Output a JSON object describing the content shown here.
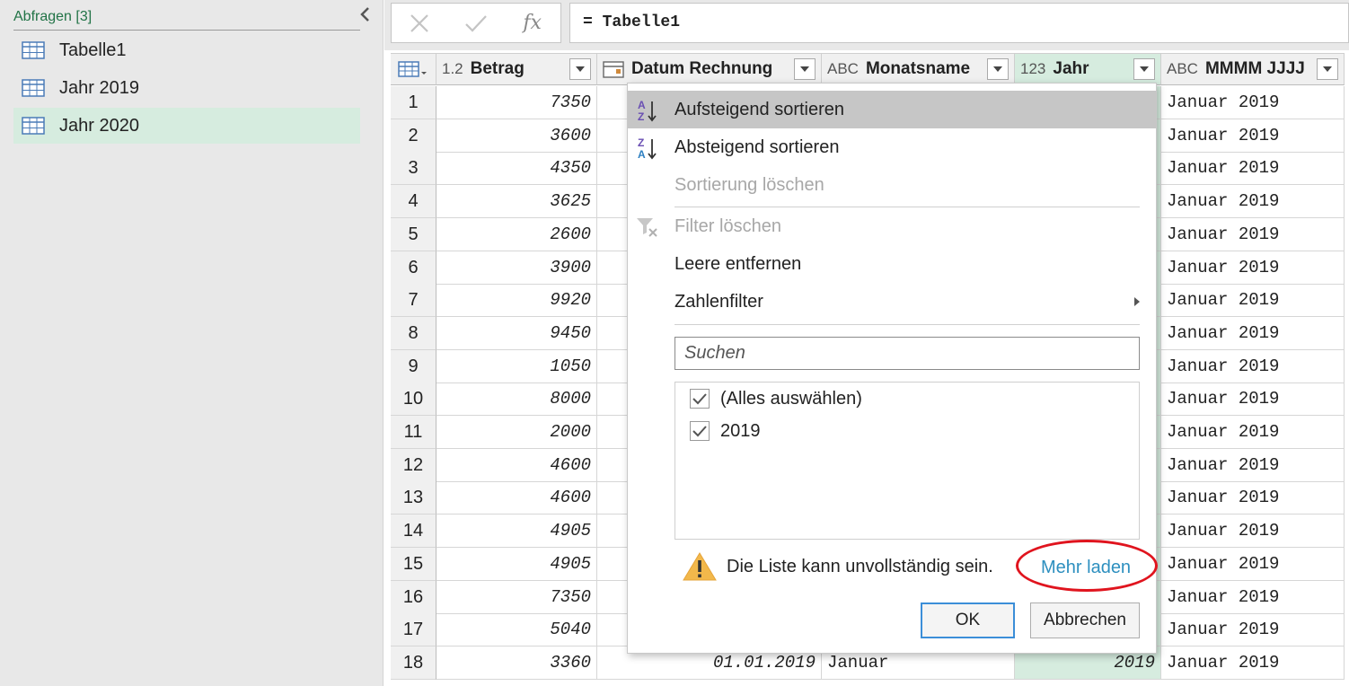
{
  "queries_pane": {
    "header": "Abfragen [3]",
    "items": [
      {
        "label": "Tabelle1",
        "selected": false
      },
      {
        "label": "Jahr 2019",
        "selected": false
      },
      {
        "label": "Jahr 2020",
        "selected": true
      }
    ]
  },
  "formula_bar": {
    "fx_label": "fx",
    "formula": "= Tabelle1"
  },
  "grid": {
    "columns": [
      {
        "type_icon": "1.2",
        "name": "Betrag"
      },
      {
        "type_icon": "calendar-icon",
        "name": "Datum Rechnung"
      },
      {
        "type_icon": "ABC",
        "name": "Monatsname"
      },
      {
        "type_icon": "123",
        "name": "Jahr"
      },
      {
        "type_icon": "ABC",
        "name": "MMMM JJJJ"
      }
    ],
    "rows": [
      {
        "num": "1",
        "betrag": "7350",
        "mmmm": "Januar 2019"
      },
      {
        "num": "2",
        "betrag": "3600",
        "mmmm": "Januar 2019"
      },
      {
        "num": "3",
        "betrag": "4350",
        "mmmm": "Januar 2019"
      },
      {
        "num": "4",
        "betrag": "3625",
        "mmmm": "Januar 2019"
      },
      {
        "num": "5",
        "betrag": "2600",
        "mmmm": "Januar 2019"
      },
      {
        "num": "6",
        "betrag": "3900",
        "mmmm": "Januar 2019"
      },
      {
        "num": "7",
        "betrag": "9920",
        "mmmm": "Januar 2019"
      },
      {
        "num": "8",
        "betrag": "9450",
        "mmmm": "Januar 2019"
      },
      {
        "num": "9",
        "betrag": "1050",
        "mmmm": "Januar 2019"
      },
      {
        "num": "10",
        "betrag": "8000",
        "mmmm": "Januar 2019"
      },
      {
        "num": "11",
        "betrag": "2000",
        "mmmm": "Januar 2019"
      },
      {
        "num": "12",
        "betrag": "4600",
        "mmmm": "Januar 2019"
      },
      {
        "num": "13",
        "betrag": "4600",
        "mmmm": "Januar 2019"
      },
      {
        "num": "14",
        "betrag": "4905",
        "mmmm": "Januar 2019"
      },
      {
        "num": "15",
        "betrag": "4905",
        "mmmm": "Januar 2019"
      },
      {
        "num": "16",
        "betrag": "7350",
        "mmmm": "Januar 2019"
      },
      {
        "num": "17",
        "betrag": "5040",
        "mmmm": "Januar 2019"
      },
      {
        "num": "18",
        "betrag": "3360",
        "datum": "01.01.2019",
        "monat": "Januar",
        "jahr": "2019",
        "mmmm": "Januar 2019"
      }
    ]
  },
  "filter_menu": {
    "sort_asc": "Aufsteigend sortieren",
    "sort_desc": "Absteigend sortieren",
    "clear_sort": "Sortierung löschen",
    "clear_filter": "Filter löschen",
    "remove_empty": "Leere entfernen",
    "number_filter": "Zahlenfilter",
    "search_placeholder": "Suchen",
    "values": [
      {
        "label": "(Alles auswählen)",
        "checked": true
      },
      {
        "label": "2019",
        "checked": true
      }
    ],
    "warning": "Die Liste kann unvollständig sein.",
    "load_more": "Mehr laden",
    "ok": "OK",
    "cancel": "Abbrechen"
  },
  "colors": {
    "accent_green": "#217346",
    "selection_green": "#d6ecdf",
    "link_blue": "#2d8fbf",
    "highlight_red": "#e0141e"
  }
}
